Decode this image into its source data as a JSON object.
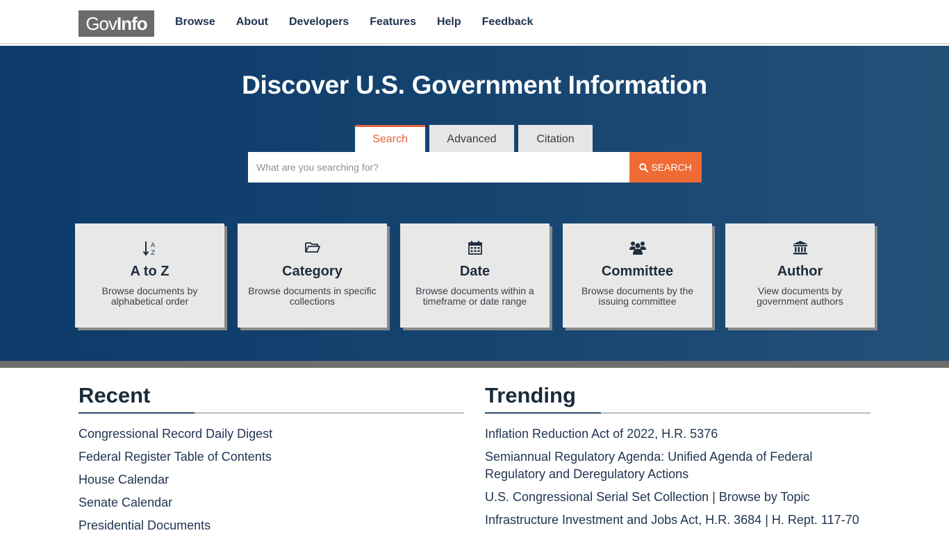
{
  "header": {
    "logo": {
      "part1": "Gov",
      "part2": "Info"
    },
    "nav": [
      "Browse",
      "About",
      "Developers",
      "Features",
      "Help",
      "Feedback"
    ]
  },
  "hero": {
    "title": "Discover U.S. Government Information",
    "tabs": [
      "Search",
      "Advanced",
      "Citation"
    ],
    "active_tab": "Search",
    "search": {
      "placeholder": "What are you searching for?",
      "value": "",
      "button_label": "SEARCH"
    }
  },
  "cards": [
    {
      "title": "A to Z",
      "desc": "Browse documents by alphabetical order",
      "icon": "sort-alpha-icon"
    },
    {
      "title": "Category",
      "desc": "Browse documents in specific collections",
      "icon": "folder-open-icon"
    },
    {
      "title": "Date",
      "desc": "Browse documents within a timeframe or date range",
      "icon": "calendar-icon"
    },
    {
      "title": "Committee",
      "desc": "Browse documents by the issuing committee",
      "icon": "users-icon"
    },
    {
      "title": "Author",
      "desc": "View documents by government authors",
      "icon": "institution-icon"
    }
  ],
  "recent": {
    "heading": "Recent",
    "items": [
      "Congressional Record Daily Digest",
      "Federal Register Table of Contents",
      "House Calendar",
      "Senate Calendar",
      "Presidential Documents"
    ]
  },
  "trending": {
    "heading": "Trending",
    "items": [
      "Inflation Reduction Act of 2022, H.R. 5376",
      "Semiannual Regulatory Agenda: Unified Agenda of Federal Regulatory and Deregulatory Actions",
      "U.S. Congressional Serial Set Collection | Browse by Topic",
      "Infrastructure Investment and Jobs Act, H.R. 3684 | H. Rept. 117-70"
    ]
  },
  "colors": {
    "accent": "#f06a35",
    "hero_dark": "#0c3a6a",
    "hero_light": "#245078",
    "text_dark": "#1f3350"
  }
}
